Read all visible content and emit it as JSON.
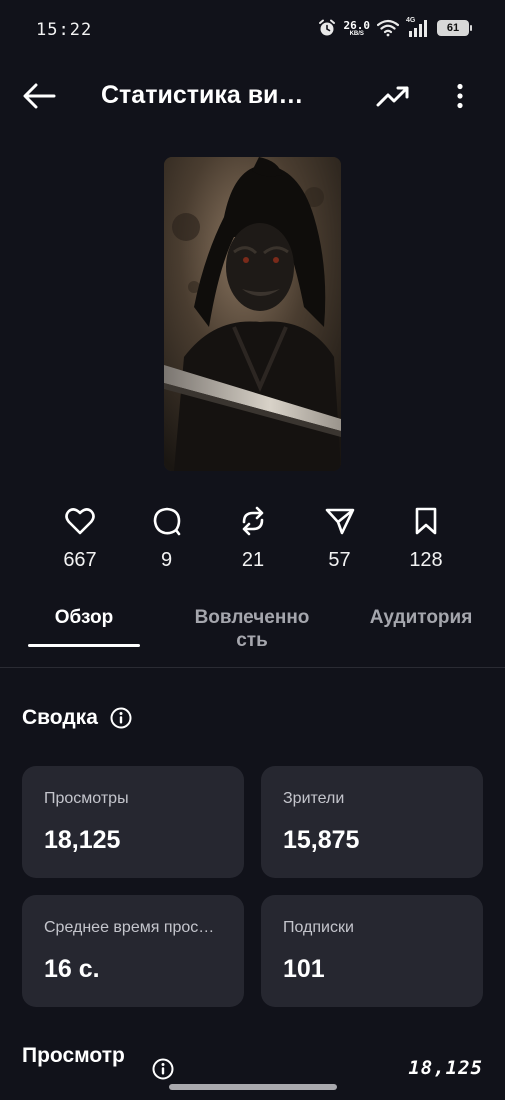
{
  "status_bar": {
    "time": "15:22",
    "net_speed_value": "26.0",
    "net_speed_unit": "KB/S",
    "network_type": "4G",
    "battery": "61",
    "icons": [
      "alarm-icon",
      "wifi-icon",
      "signal-icon",
      "battery-icon"
    ]
  },
  "header": {
    "title": "Статистика ви…",
    "back_icon": "arrow-left-icon",
    "trend_icon": "trending-up-icon",
    "more_icon": "more-vertical-icon"
  },
  "engagement": [
    {
      "icon": "heart-icon",
      "value": "667"
    },
    {
      "icon": "comment-icon",
      "value": "9"
    },
    {
      "icon": "repost-icon",
      "value": "21"
    },
    {
      "icon": "share-icon",
      "value": "57"
    },
    {
      "icon": "bookmark-icon",
      "value": "128"
    }
  ],
  "tabs": [
    {
      "label": "Обзор",
      "active": true
    },
    {
      "label": "Вовлеченно\nсть",
      "active": false
    },
    {
      "label": "Аудитория",
      "active": false
    }
  ],
  "summary": {
    "title": "Сводка",
    "cards": [
      {
        "label": "Просмотры",
        "value": "18,125"
      },
      {
        "label": "Зрители",
        "value": "15,875"
      },
      {
        "label": "Среднее время прос…",
        "value": "16 с."
      },
      {
        "label": "Подписки",
        "value": "101"
      }
    ]
  },
  "views_section": {
    "title": "Просмотр",
    "total": "18,125"
  },
  "colors": {
    "background": "#11121a",
    "card": "#262730",
    "text_primary": "#ffffff",
    "text_secondary": "#c4c5cc",
    "tab_inactive": "#a5a6ad"
  }
}
